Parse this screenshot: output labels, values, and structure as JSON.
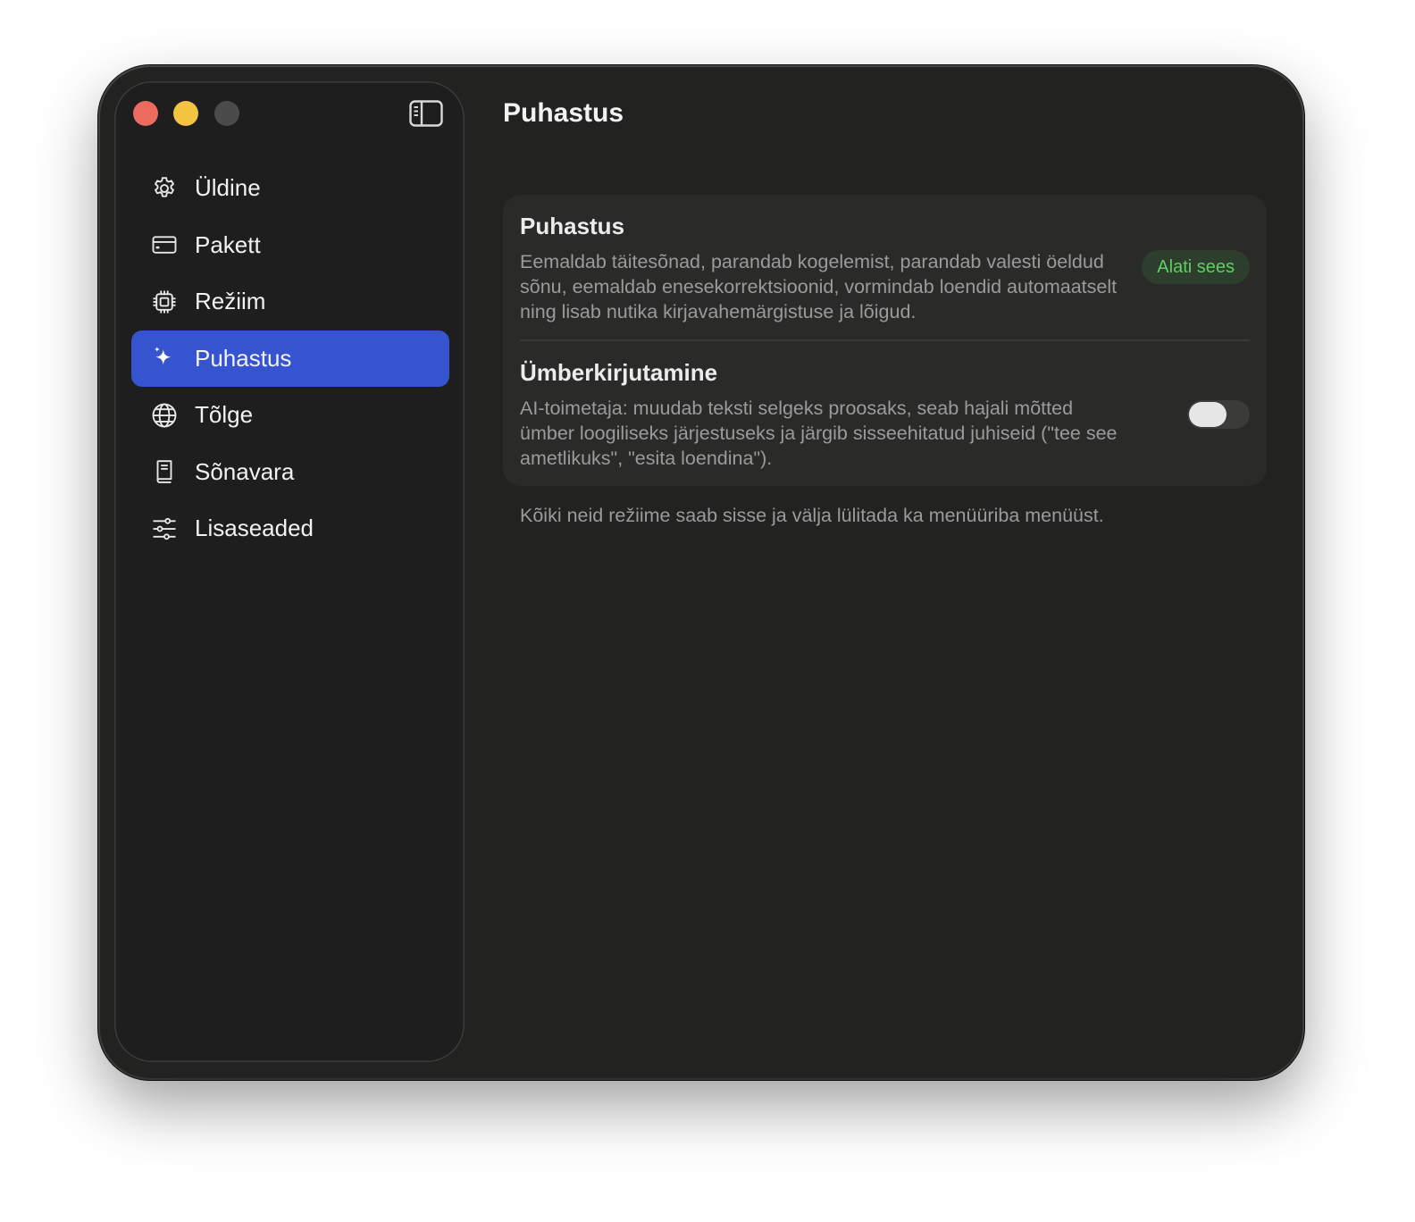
{
  "window": {
    "controls": [
      "close",
      "minimize",
      "maximize"
    ]
  },
  "sidebar": {
    "toggle_icon": "sidebar-toggle-icon",
    "items": [
      {
        "label": "Üldine",
        "icon": "gear-icon",
        "active": false
      },
      {
        "label": "Pakett",
        "icon": "credit-card-icon",
        "active": false
      },
      {
        "label": "Režiim",
        "icon": "cpu-icon",
        "active": false
      },
      {
        "label": "Puhastus",
        "icon": "sparkles-icon",
        "active": true
      },
      {
        "label": "Tõlge",
        "icon": "globe-icon",
        "active": false
      },
      {
        "label": "Sõnavara",
        "icon": "book-icon",
        "active": false
      },
      {
        "label": "Lisaseaded",
        "icon": "sliders-icon",
        "active": false
      }
    ],
    "accent_color": "#3654d0"
  },
  "main": {
    "title": "Puhastus",
    "card": {
      "rows": [
        {
          "title": "Puhastus",
          "description": "Eemaldab täitesõnad, parandab kogelemist, parandab valesti öeldud sõnu, eemaldab enesekorrektsioonid, vormindab loendid automaatselt ning lisab nutika kirjavahemärgistuse ja lõigud.",
          "badge": "Alati sees",
          "badge_color": "#5fcf62"
        },
        {
          "title": "Ümberkirjutamine",
          "description": "AI-toimetaja: muudab teksti selgeks proosaks, seab hajali mõtted ümber loogiliseks järjestuseks ja järgib sisseehitatud juhiseid (\"tee see ametlikuks\", \"esita loendina\").",
          "toggle_on": false
        }
      ]
    },
    "footnote": "Kõiki neid režiime saab sisse ja välja lülitada ka menüüriba menüüst."
  }
}
